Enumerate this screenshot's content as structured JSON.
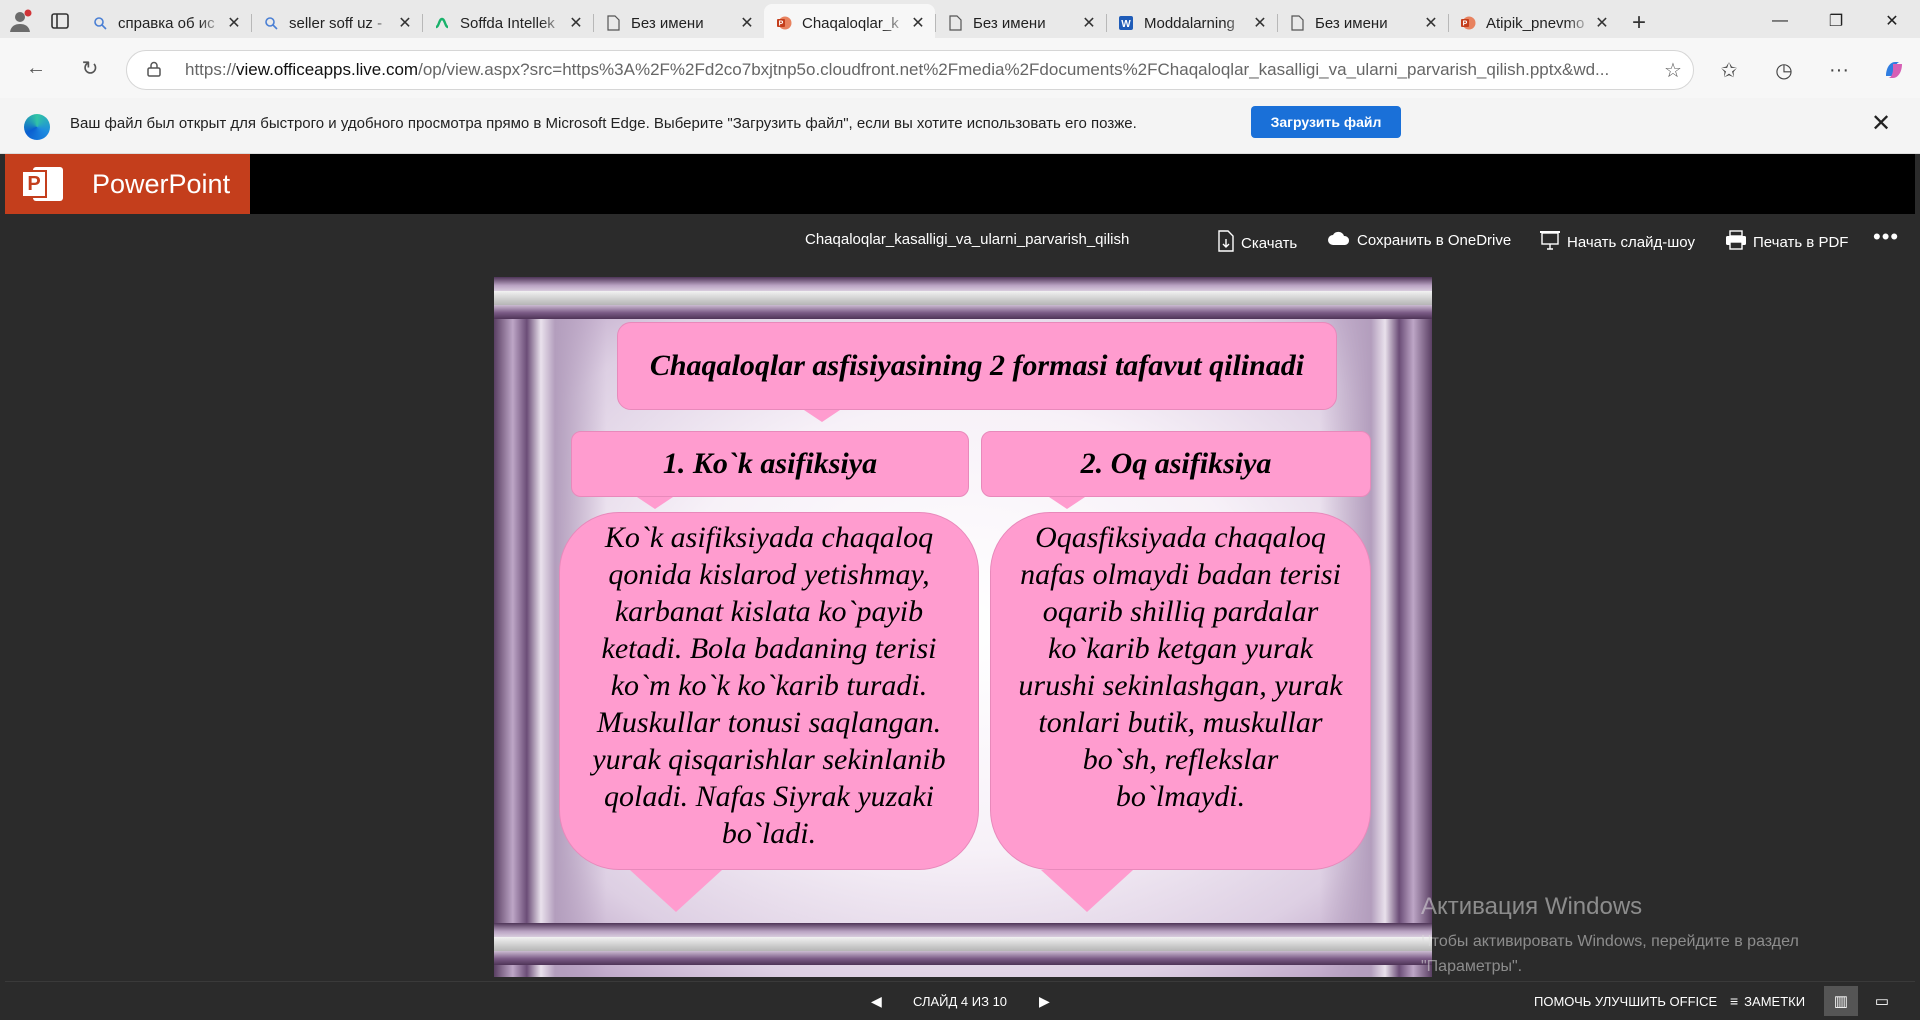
{
  "browser": {
    "tabs": [
      {
        "title": "справка об ис",
        "icon": "search-icon"
      },
      {
        "title": "seller soff uz -",
        "icon": "search-icon"
      },
      {
        "title": "Soffda Intellek",
        "icon": "soffda-icon"
      },
      {
        "title": "Без имени",
        "icon": "document-icon"
      },
      {
        "title": "Chaqaloqlar_k",
        "icon": "powerpoint-icon",
        "active": true
      },
      {
        "title": "Без имени",
        "icon": "document-icon"
      },
      {
        "title": "Moddalarning",
        "icon": "word-icon"
      },
      {
        "title": "Без имени",
        "icon": "document-icon"
      },
      {
        "title": "Atipik_pnevmo",
        "icon": "powerpoint-icon"
      }
    ],
    "url_prefix": "https://",
    "url_host": "view.officeapps.live.com",
    "url_rest": "/op/view.aspx?src=https%3A%2F%2Fd2co7bxjtnp5o.cloudfront.net%2Fmedia%2Fdocuments%2FChaqaloqlar_kasalligi_va_ularni_parvarish_qilish.pptx&wd..."
  },
  "infobar": {
    "message": "Ваш файл был открыт для быстрого и удобного просмотра прямо в Microsoft Edge. Выберите \"Загрузить файл\", если вы хотите использовать его позже.",
    "download_label": "Загрузить файл"
  },
  "app": {
    "brand": "PowerPoint",
    "file_name": "Chaqaloqlar_kasalligi_va_ularni_parvarish_qilish",
    "download": "Скачать",
    "save_onedrive": "Сохранить в OneDrive",
    "slideshow": "Начать слайд-шоу",
    "print_pdf": "Печать в PDF"
  },
  "slide": {
    "title": "Chaqaloqlar asfisiyasining 2 formasi tafavut qilinadi",
    "left_heading": "1. Ko`k asifiksiya",
    "right_heading": "2. Oq asifiksiya",
    "left_text": "Ko`k asifiksiyada chaqaloq qonida kislarod yetishmay, karbanat kislata ko`payib ketadi. Bola badaning terisi ko`m ko`k ko`karib turadi. Muskullar tonusi saqlangan. yurak qisqarishlar sekinlanib qoladi. Nafas Siyrak yuzaki bo`ladi.",
    "right_text": "Oqasfiksiyada chaqaloq nafas olmaydi badan terisi oqarib shilliq pardalar ko`karib ketgan yurak urushi sekinlashgan, yurak tonlari butik, muskullar bo`sh, reflekslar bo`lmaydi."
  },
  "status": {
    "slide_indicator": "СЛАЙД 4 ИЗ 10",
    "help": "ПОМОЧЬ УЛУЧШИТЬ OFFICE",
    "notes": "ЗАМЕТКИ"
  },
  "watermark": {
    "title": "Активация Windows",
    "line1": "Чтобы активировать Windows, перейдите в раздел",
    "line2": "\"Параметры\"."
  },
  "colors": {
    "brand": "#c43e1c",
    "accent_button": "#1a70d8",
    "slide_box": "#ff9ccf"
  }
}
